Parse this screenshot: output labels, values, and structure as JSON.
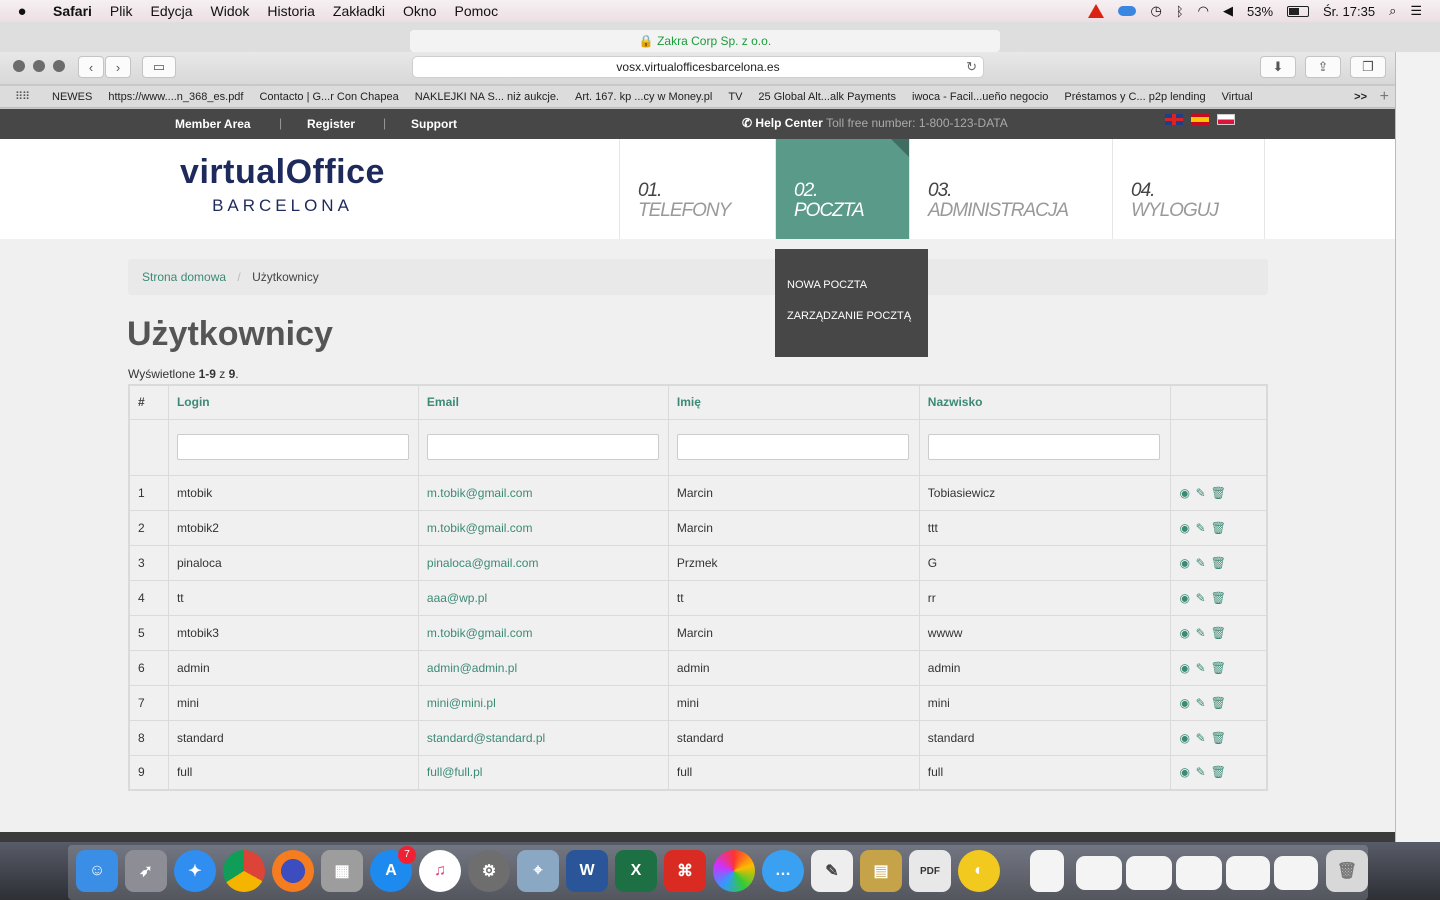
{
  "menubar": {
    "app": "Safari",
    "items": [
      "Plik",
      "Edycja",
      "Widok",
      "Historia",
      "Zakładki",
      "Okno",
      "Pomoc"
    ],
    "battery": "53%",
    "clock": "Śr. 17:35"
  },
  "browser": {
    "ghost_url": "🔒 Zakra Corp Sp. z o.o.",
    "url": "vosx.virtualofficesbarcelona.es",
    "bookmarks": [
      "NEWES",
      "https://www....n_368_es.pdf",
      "Contacto | G...r Con Chapea",
      "NAKLEJKI NA S... niż aukcje.",
      "Art. 167. kp ...cy w Money.pl",
      "TV",
      "25 Global Alt...alk Payments",
      "iwoca - Facil...ueño negocio",
      "Préstamos y C... p2p lending",
      "Virtual"
    ],
    "more": ">>"
  },
  "topnav": {
    "member_area": "Member Area",
    "register": "Register",
    "support": "Support",
    "separator": "|",
    "help_center": "Help Center",
    "toll_free": "Toll free number: 1-800-123-DATA"
  },
  "logo": {
    "line1": "virtualOffice",
    "line2": "BARCELONA"
  },
  "mainnav": [
    {
      "num": "01.",
      "label": "TELEFONY"
    },
    {
      "num": "02.",
      "label": "POCZTA"
    },
    {
      "num": "03.",
      "label": "ADMINISTRACJA"
    },
    {
      "num": "04.",
      "label": "WYLOGUJ"
    }
  ],
  "dropdown": {
    "items": [
      "NOWA POCZTA",
      "ZARZĄDZANIE POCZTĄ"
    ]
  },
  "breadcrumb": {
    "home": "Strona domowa",
    "divider": "/",
    "current": "Użytkownicy"
  },
  "page": {
    "title": "Użytkownicy",
    "summary_prefix": "Wyświetlone ",
    "summary_range": "1-9",
    "summary_mid": " z ",
    "summary_total": "9",
    "summary_suffix": "."
  },
  "table": {
    "headers": [
      "#",
      "Login",
      "Email",
      "Imię",
      "Nazwisko"
    ],
    "rows": [
      {
        "n": "1",
        "login": "mtobik",
        "email": "m.tobik@gmail.com",
        "first": "Marcin",
        "last": "Tobiasiewicz"
      },
      {
        "n": "2",
        "login": "mtobik2",
        "email": "m.tobik@gmail.com",
        "first": "Marcin",
        "last": "ttt"
      },
      {
        "n": "3",
        "login": "pinaloca",
        "email": "pinaloca@gmail.com",
        "first": "Przmek",
        "last": "G"
      },
      {
        "n": "4",
        "login": "tt",
        "email": "aaa@wp.pl",
        "first": "tt",
        "last": "rr"
      },
      {
        "n": "5",
        "login": "mtobik3",
        "email": "m.tobik@gmail.com",
        "first": "Marcin",
        "last": "wwww"
      },
      {
        "n": "6",
        "login": "admin",
        "email": "admin@admin.pl",
        "first": "admin",
        "last": "admin"
      },
      {
        "n": "7",
        "login": "mini",
        "email": "mini@mini.pl",
        "first": "mini",
        "last": "mini"
      },
      {
        "n": "8",
        "login": "standard",
        "email": "standard@standard.pl",
        "first": "standard",
        "last": "standard"
      },
      {
        "n": "9",
        "login": "full",
        "email": "full@full.pl",
        "first": "full",
        "last": "full"
      }
    ],
    "action_icons": [
      "eye-icon",
      "pencil-icon",
      "trash-icon"
    ]
  },
  "dock": {
    "appstore_badge": "7"
  },
  "colors": {
    "accent": "#3c8a75",
    "nav_active": "#5a9a88",
    "dark_bar": "#474747"
  }
}
